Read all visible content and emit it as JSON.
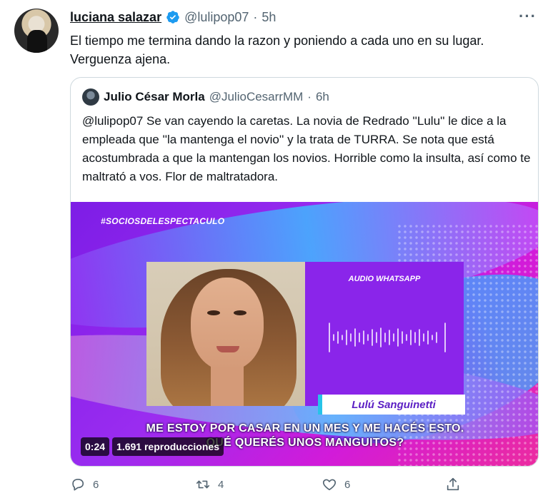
{
  "tweet": {
    "display_name": "luciana salazar",
    "handle": "@lulipop07",
    "separator": "·",
    "time": "5h",
    "more_label": "···",
    "text": "El tiempo me termina dando la razon y poniendo a cada uno en su lugar. Verguenza ajena."
  },
  "quote": {
    "display_name": "Julio César Morla",
    "handle": "@JulioCesarrMM",
    "separator": "·",
    "time": "6h",
    "text": "@lulipop07 Se van cayendo la caretas. La novia de Redrado ''Lulu'' le dice a la empleada que ''la mantenga el novio'' y la trata de TURRA. Se nota que está acostumbrada a que la mantengan los novios. Horrible como la insulta, así como te maltrató a vos. Flor de maltratadora."
  },
  "media": {
    "hashtag": "#SOCIOSDELESPECTACULO",
    "audio_label": "AUDIO WHATSAPP",
    "name_tag": "Lulú Sanguinetti",
    "subtitle_line1": "ME ESTOY POR CASAR EN UN MES Y ME HACÉS ESTO.",
    "subtitle_line2": "QUÉ QUERÉS UNOS MANGUITOS?",
    "duration": "0:24",
    "views": "1.691 reproducciones"
  },
  "actions": {
    "replies": "6",
    "retweets": "4",
    "likes": "6"
  },
  "colors": {
    "verified": "#1d9bf0",
    "secondary_text": "#536471",
    "media_purple": "#8a25ea",
    "media_pink": "#ec2b9f"
  },
  "icons": [
    "verified-badge-icon",
    "more-icon",
    "reply-icon",
    "retweet-icon",
    "like-icon",
    "share-icon"
  ]
}
